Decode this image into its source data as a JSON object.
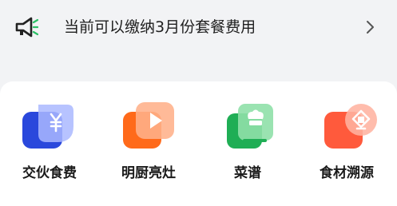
{
  "notice": {
    "icon": "megaphone-icon",
    "text": "当前可以缴纳3月份套餐费用",
    "chevron_icon": "chevron-right-icon"
  },
  "services": [
    {
      "label": "交伙食费",
      "icon": "yuan-payment-icon",
      "color": "#2d4de0"
    },
    {
      "label": "明厨亮灶",
      "icon": "video-play-icon",
      "color": "#ff6a1a"
    },
    {
      "label": "菜谱",
      "icon": "chef-book-icon",
      "color": "#1fb35a"
    },
    {
      "label": "食材溯源",
      "icon": "trace-location-icon",
      "color": "#ff5a3c"
    }
  ],
  "colors": {
    "accent_green": "#1fb35a",
    "background": "#f2f3f5"
  }
}
